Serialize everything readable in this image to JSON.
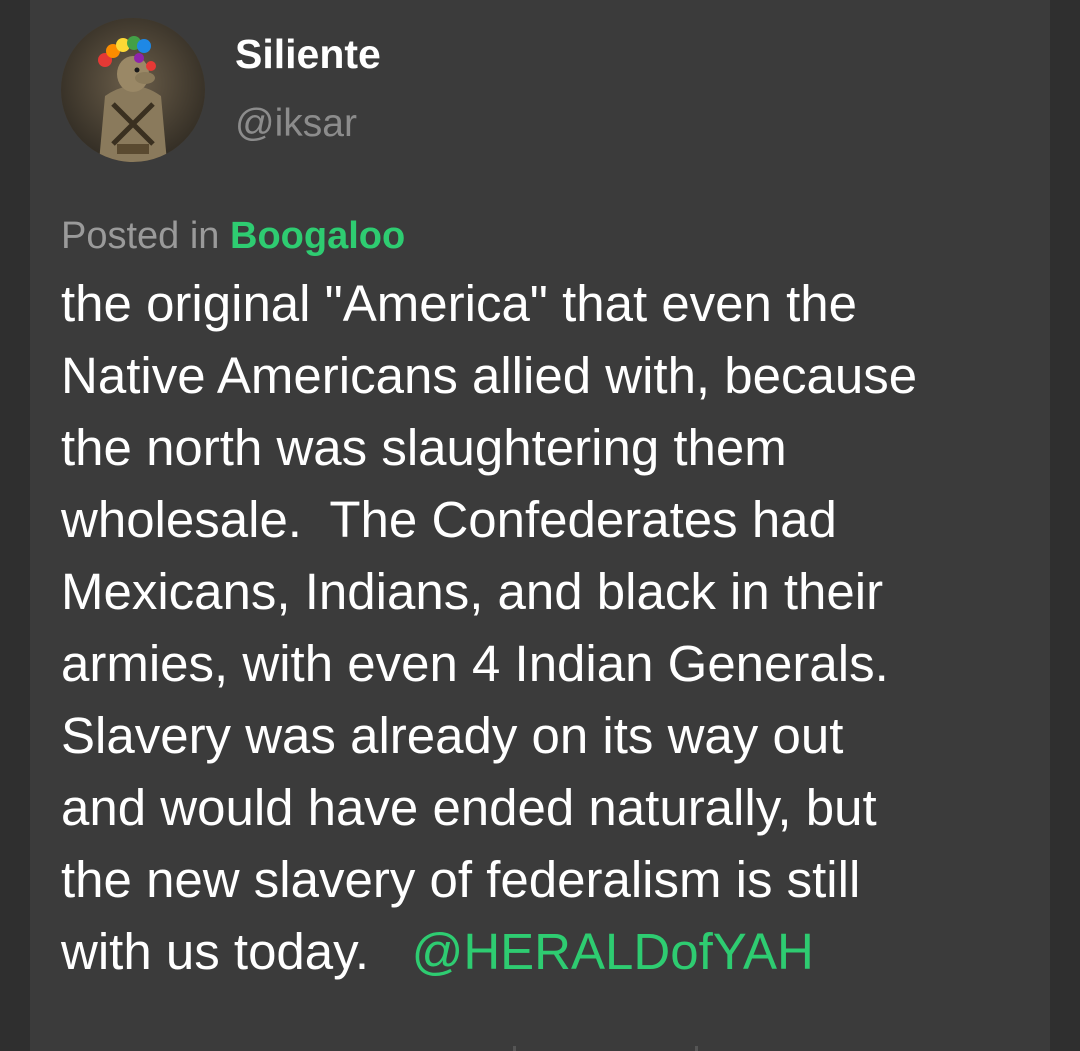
{
  "user": {
    "display_name": "Siliente",
    "handle": "@iksar",
    "avatar_icon": "avatar-image"
  },
  "post": {
    "posted_in_prefix": "Posted in ",
    "community": "Boogaloo",
    "lines": [
      "the original \"America\" that even the",
      "Native Americans allied with, because",
      "the north was slaughtering them",
      "wholesale.  The Confederates had",
      "Mexicans, Indians, and black in their",
      "armies, with even 4 Indian Generals.",
      "Slavery was already on its way out",
      "and would have ended naturally, but",
      "the new slavery of federalism is still"
    ],
    "last_line_text": "with us today.   ",
    "mention": "@HERALDofYAH"
  },
  "colors": {
    "background": "#2f2f2f",
    "card": "#3b3b3b",
    "accent_green": "#2ecc71",
    "muted_text": "#8c8c8c",
    "body_text": "#ffffff"
  }
}
